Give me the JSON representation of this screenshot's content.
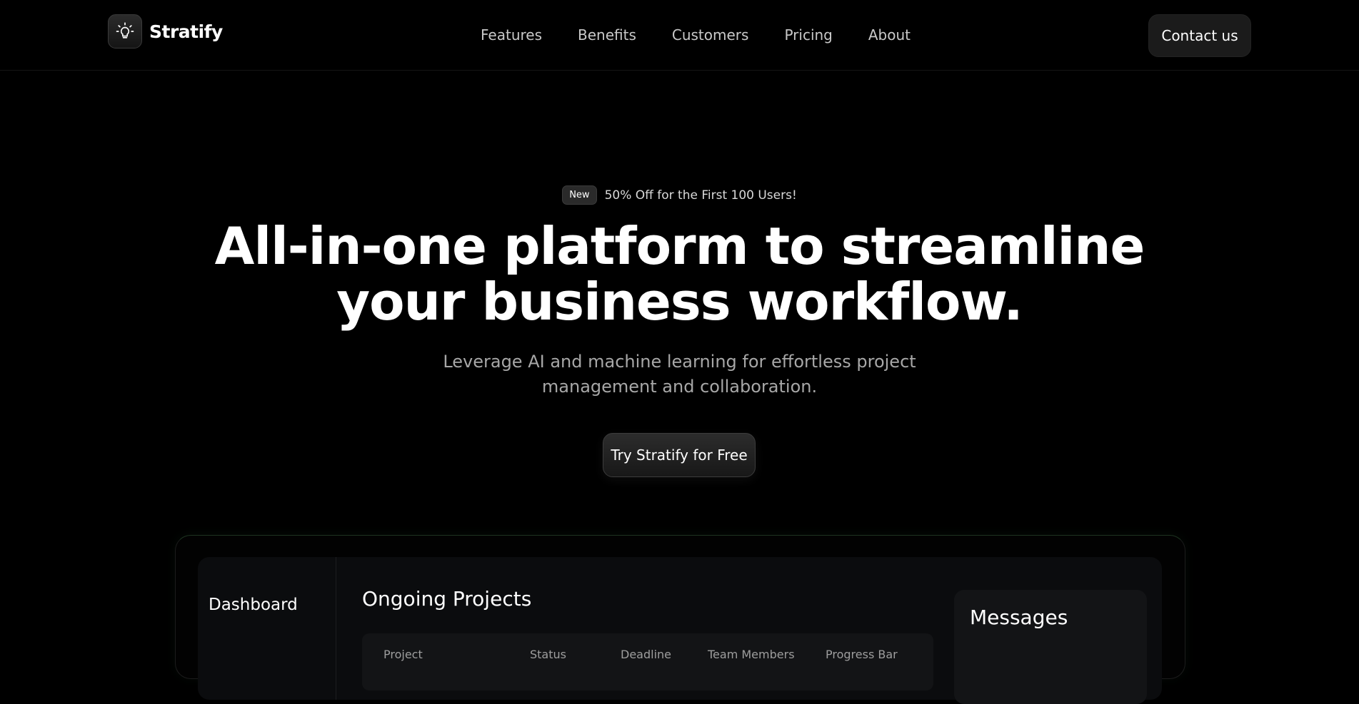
{
  "brand": {
    "name": "Stratify",
    "logo_icon": "lightbulb-icon"
  },
  "nav": {
    "items": [
      {
        "label": "Features"
      },
      {
        "label": "Benefits"
      },
      {
        "label": "Customers"
      },
      {
        "label": "Pricing"
      },
      {
        "label": "About"
      }
    ],
    "contact_label": "Contact us"
  },
  "hero": {
    "badge": "New",
    "badge_text": "50% Off for the First 100 Users!",
    "title_line1": "All-in-one platform to streamline",
    "title_line2": "your business workflow.",
    "subtitle_line1": "Leverage AI and machine learning for effortless project",
    "subtitle_line2": "management and collaboration.",
    "cta_label": "Try Stratify for Free"
  },
  "dashboard": {
    "sidebar_title": "Dashboard",
    "main_title": "Ongoing Projects",
    "columns": [
      "Project",
      "Status",
      "Deadline",
      "Team Members",
      "Progress Bar"
    ],
    "messages_title": "Messages"
  },
  "colors": {
    "background": "#000000",
    "button_bg": "#1b1b1b",
    "muted_text": "#a7a7a7",
    "frame_glow": "#1d3320"
  }
}
